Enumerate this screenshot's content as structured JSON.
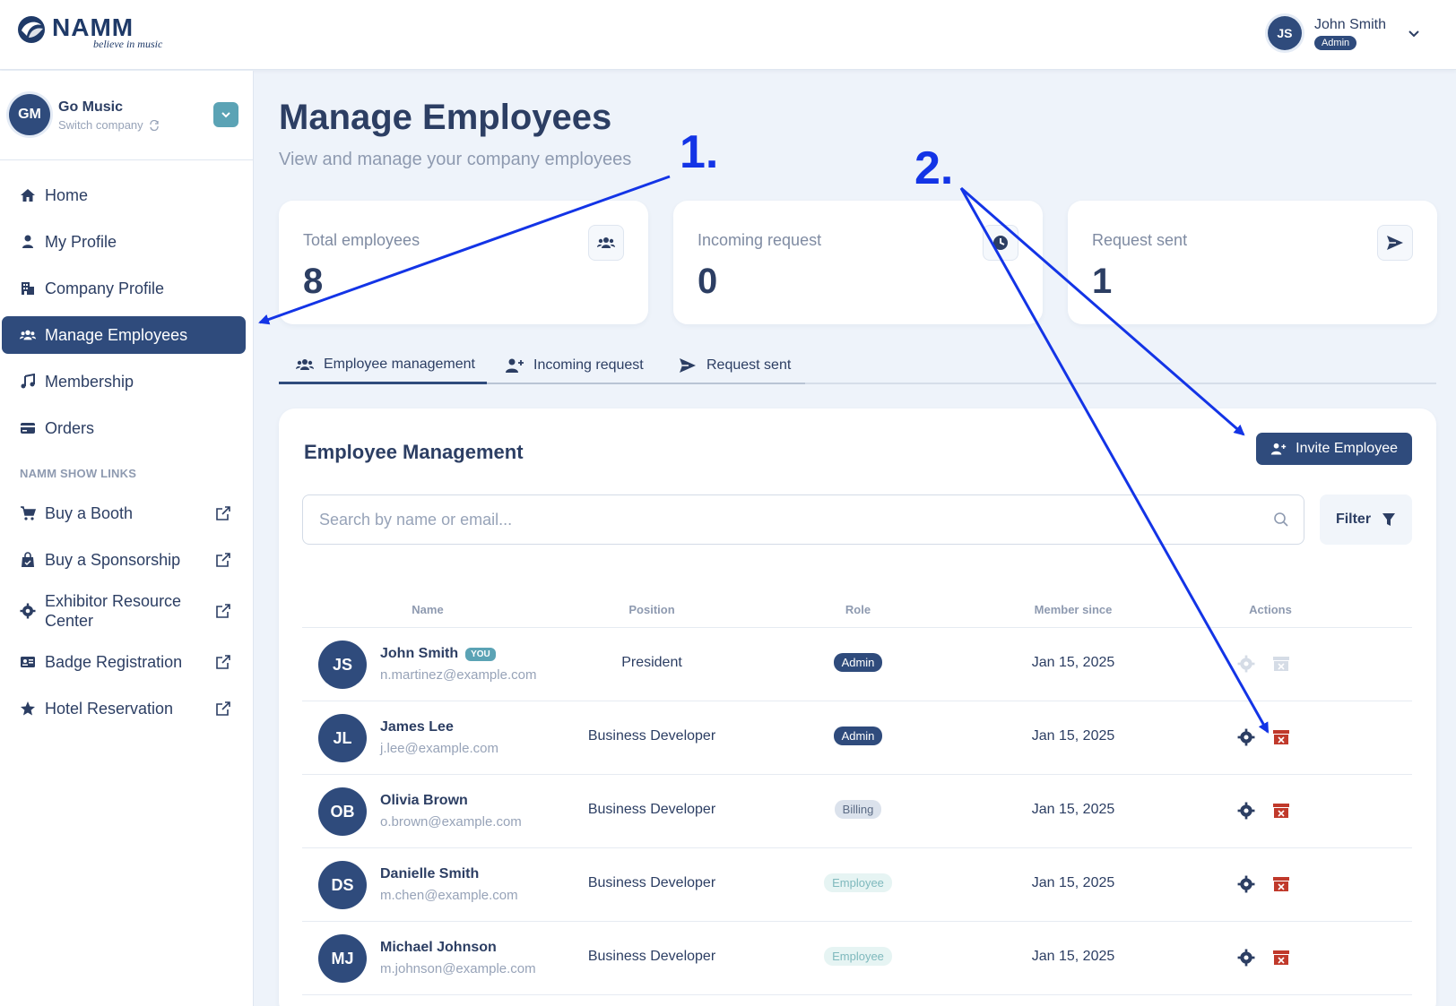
{
  "header": {
    "logo_word": "NAMM",
    "logo_tagline": "believe in music",
    "user_initials": "JS",
    "user_name": "John Smith",
    "user_role": "Admin"
  },
  "sidebar": {
    "company_initials": "GM",
    "company_name": "Go Music",
    "switch_label": "Switch company",
    "items": [
      {
        "label": "Home",
        "icon": "home-icon"
      },
      {
        "label": "My Profile",
        "icon": "user-icon"
      },
      {
        "label": "Company Profile",
        "icon": "building-icon"
      },
      {
        "label": "Manage Employees",
        "icon": "users-icon",
        "active": true
      },
      {
        "label": "Membership",
        "icon": "music-icon"
      },
      {
        "label": "Orders",
        "icon": "card-icon"
      }
    ],
    "section_title": "NAMM SHOW LINKS",
    "links": [
      {
        "label": "Buy a Booth",
        "icon": "cart-icon"
      },
      {
        "label": "Buy a Sponsorship",
        "icon": "bag-icon"
      },
      {
        "label": "Exhibitor Resource Center",
        "icon": "gear-icon"
      },
      {
        "label": "Badge Registration",
        "icon": "badge-icon"
      },
      {
        "label": "Hotel Reservation",
        "icon": "star-icon"
      }
    ]
  },
  "main": {
    "title": "Manage Employees",
    "subtitle": "View and manage your company employees",
    "stats": [
      {
        "label": "Total employees",
        "value": "8",
        "icon": "users-icon"
      },
      {
        "label": "Incoming request",
        "value": "0",
        "icon": "clock-icon"
      },
      {
        "label": "Request sent",
        "value": "1",
        "icon": "send-icon"
      }
    ],
    "tabs": [
      {
        "label": "Employee management",
        "icon": "users-icon",
        "active": true
      },
      {
        "label": "Incoming request",
        "icon": "user-plus-icon"
      },
      {
        "label": "Request sent",
        "icon": "send-icon"
      }
    ],
    "panel_title": "Employee Management",
    "invite_label": "Invite Employee",
    "search_placeholder": "Search by name or email...",
    "filter_label": "Filter",
    "columns": [
      "Name",
      "Position",
      "Role",
      "Member since",
      "Actions"
    ],
    "rows": [
      {
        "initials": "JS",
        "name": "John Smith",
        "you": "YOU",
        "email": "n.martinez@example.com",
        "position": "President",
        "role": "Admin",
        "since": "Jan 15, 2025",
        "actions_enabled": false
      },
      {
        "initials": "JL",
        "name": "James Lee",
        "email": "j.lee@example.com",
        "position": "Business Developer",
        "role": "Admin",
        "since": "Jan 15, 2025",
        "actions_enabled": true
      },
      {
        "initials": "OB",
        "name": "Olivia Brown",
        "email": "o.brown@example.com",
        "position": "Business Developer",
        "role": "Billing",
        "since": "Jan 15, 2025",
        "actions_enabled": true
      },
      {
        "initials": "DS",
        "name": "Danielle Smith",
        "email": "m.chen@example.com",
        "position": "Business Developer",
        "role": "Employee",
        "since": "Jan 15, 2025",
        "actions_enabled": true
      },
      {
        "initials": "MJ",
        "name": "Michael Johnson",
        "email": "m.johnson@example.com",
        "position": "Business Developer",
        "role": "Employee",
        "since": "Jan 15, 2025",
        "actions_enabled": true
      }
    ]
  },
  "annotations": {
    "label_1": "1.",
    "label_2": "2.",
    "color": "#1334e6"
  },
  "colors": {
    "primary": "#2f4b7c",
    "accent": "#5ba3b5",
    "danger": "#c0392b",
    "background": "#eef3fa"
  }
}
